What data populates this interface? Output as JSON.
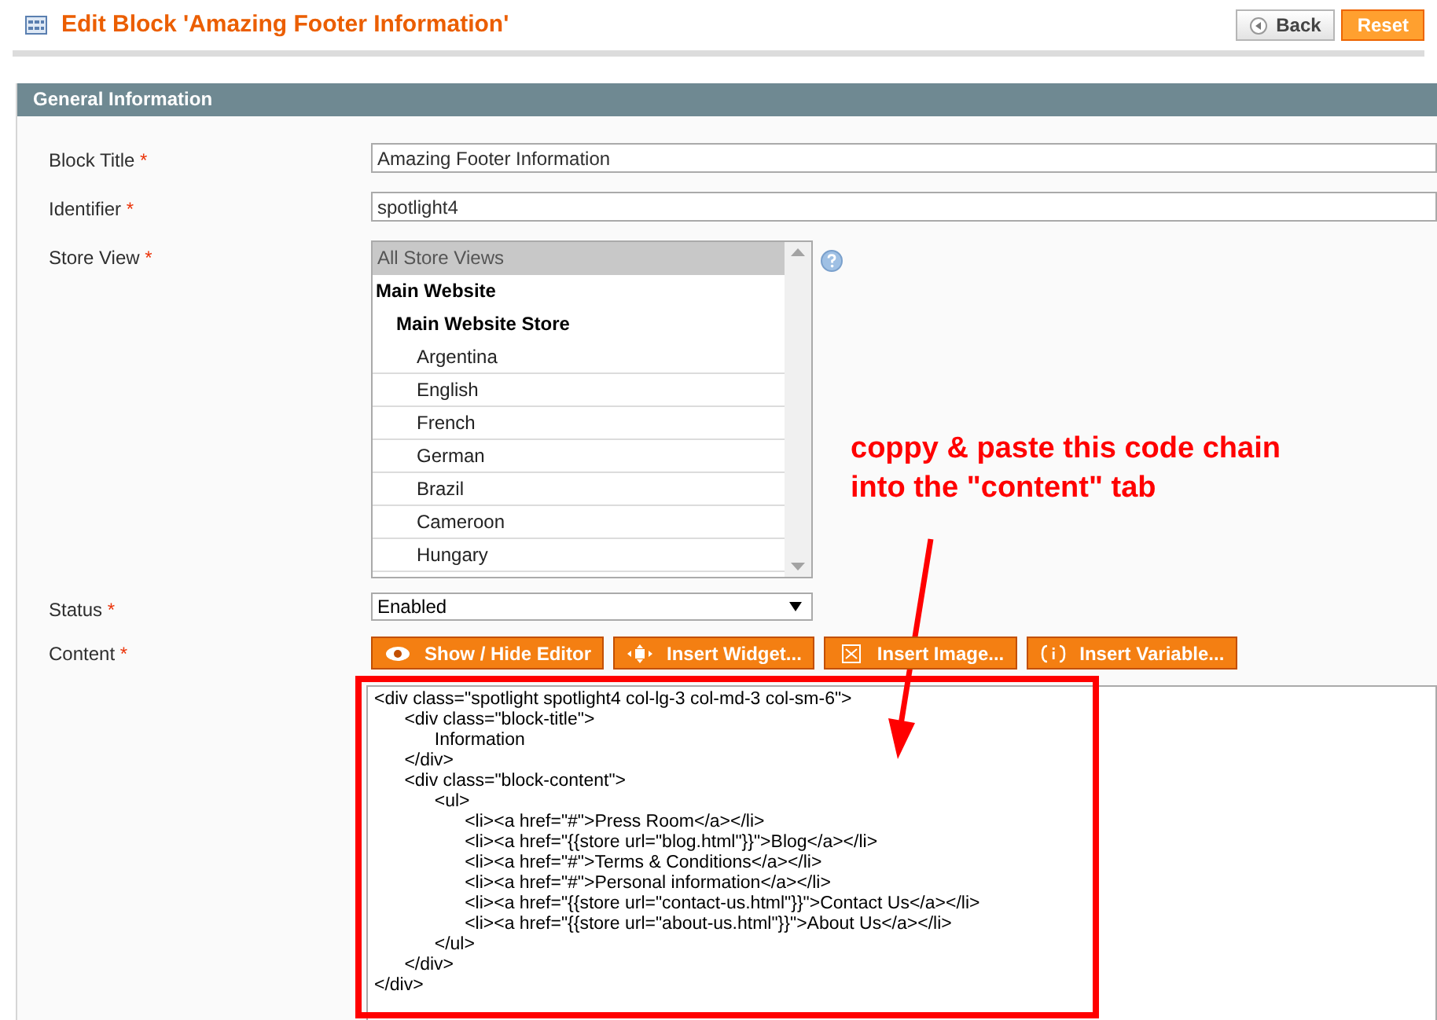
{
  "header": {
    "title": "Edit Block 'Amazing Footer Information'",
    "buttons": [
      {
        "label": "Back",
        "kind": "back"
      },
      {
        "label": "Reset",
        "kind": "primary"
      }
    ]
  },
  "section": {
    "title": "General Information"
  },
  "fields": [
    {
      "label": "Block Title",
      "required_mark": "*",
      "kind": "text",
      "value": "Amazing Footer Information"
    },
    {
      "label": "Identifier",
      "required_mark": "*",
      "kind": "text",
      "value": "spotlight4"
    },
    {
      "label": "Store View",
      "required_mark": "*",
      "kind": "multiselect",
      "options": [
        {
          "label": "All Store Views",
          "selected": true
        },
        {
          "label": "Main Website",
          "selected": false,
          "children": [
            {
              "label": "Main Website Store",
              "selected": false,
              "children": [
                {
                  "label": "Argentina",
                  "selected": false
                },
                {
                  "label": "English",
                  "selected": false
                },
                {
                  "label": "French",
                  "selected": false
                },
                {
                  "label": "German",
                  "selected": false
                },
                {
                  "label": "Brazil",
                  "selected": false
                },
                {
                  "label": "Cameroon",
                  "selected": false
                },
                {
                  "label": "Hungary",
                  "selected": false
                }
              ]
            }
          ]
        }
      ]
    },
    {
      "label": "Status",
      "required_mark": "*",
      "kind": "select",
      "value": "Enabled"
    },
    {
      "label": "Content",
      "required_mark": "*",
      "kind": "editor",
      "buttons": [
        {
          "label": "Show / Hide Editor"
        },
        {
          "label": "Insert Widget..."
        },
        {
          "label": "Insert Image..."
        },
        {
          "label": "Insert Variable..."
        }
      ],
      "code_lines": [
        "<div class=\"spotlight spotlight4 col-lg-3 col-md-3 col-sm-6\">",
        "\t<div class=\"block-title\">",
        "\t\tInformation",
        "\t</div>",
        "\t<div class=\"block-content\">",
        "\t\t<ul>",
        "\t\t\t<li><a href=\"#\">Press Room</a></li>",
        "\t\t\t<li><a href=\"{{store url=\"blog.html\"}}\">Blog</a></li>",
        "\t\t\t<li><a href=\"#\">Terms & Conditions</a></li>",
        "\t\t\t<li><a href=\"#\">Personal information</a></li>",
        "\t\t\t<li><a href=\"{{store url=\"contact-us.html\"}}\">Contact Us</a></li>",
        "\t\t\t<li><a href=\"{{store url=\"about-us.html\"}}\">About Us</a></li>",
        "\t\t</ul>",
        "\t</div>",
        "</div>"
      ]
    }
  ],
  "annotation": {
    "lines": [
      "coppy & paste this code chain",
      "into the \"content\" tab"
    ]
  }
}
